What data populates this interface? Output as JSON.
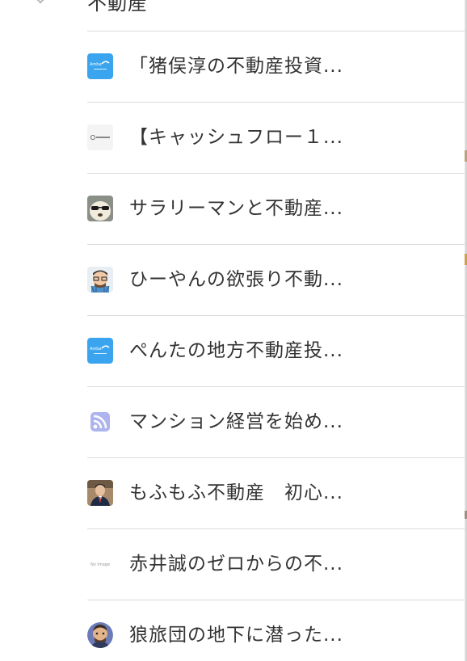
{
  "section": {
    "title": "不動産",
    "chevron_icon": "chevron-down-icon"
  },
  "feeds": [
    {
      "title": "「猪俣淳の不動産投資...",
      "icon": "blog-logo-icon"
    },
    {
      "title": "【キャッシュフロー１...",
      "icon": "site-logo-icon"
    },
    {
      "title": "サラリーマンと不動産...",
      "icon": "dog-sunglasses-avatar-icon"
    },
    {
      "title": "ひーやんの欲張り不動...",
      "icon": "cartoon-glasses-avatar-icon"
    },
    {
      "title": "ぺんたの地方不動産投...",
      "icon": "blog-logo-icon"
    },
    {
      "title": "マンション経営を始め...",
      "icon": "rss-icon"
    },
    {
      "title": "もふもふ不動産　初心...",
      "icon": "man-suit-avatar-icon"
    },
    {
      "title": "赤井誠のゼロからの不...",
      "icon": "no-image-icon"
    },
    {
      "title": "狼旅団の地下に潜った...",
      "icon": "cartoon-man-avatar-icon"
    }
  ],
  "favicon_texts": {
    "no_image": "No Image",
    "site_logo": "ⓗ Homeing"
  },
  "colors": {
    "text": "#333333",
    "divider": "#dcdcdc",
    "blog_logo_blue": "#3aa5ee",
    "rss_lavender": "#aeb4ee"
  }
}
